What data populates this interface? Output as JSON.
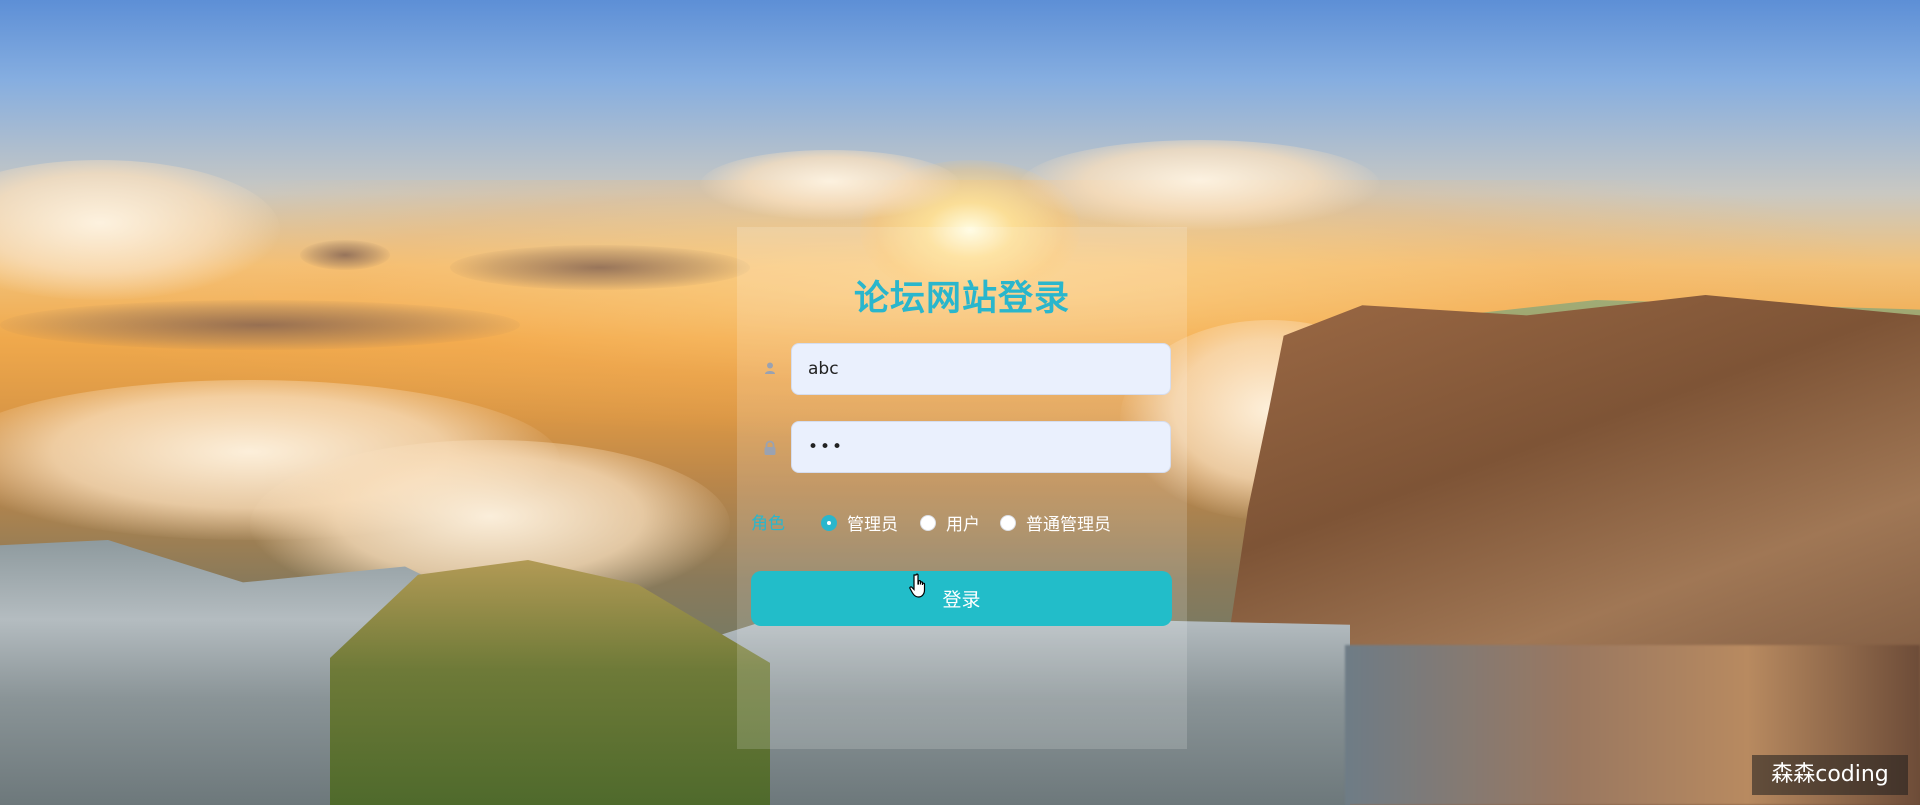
{
  "login": {
    "title": "论坛网站登录",
    "username": {
      "value": "abc",
      "placeholder": ""
    },
    "password": {
      "value": "•••",
      "placeholder": ""
    },
    "role_label": "角色",
    "roles": [
      {
        "label": "管理员",
        "checked": true
      },
      {
        "label": "用户",
        "checked": false
      },
      {
        "label": "普通管理员",
        "checked": false
      }
    ],
    "submit_label": "登录"
  },
  "watermark": "森森coding",
  "icons": {
    "user": "user-icon",
    "lock": "lock-icon",
    "pointer": "hand-cursor-icon"
  },
  "colors": {
    "accent": "#2ab6cc",
    "button": "#22bdc9",
    "field_bg": "#eaf0fd"
  }
}
